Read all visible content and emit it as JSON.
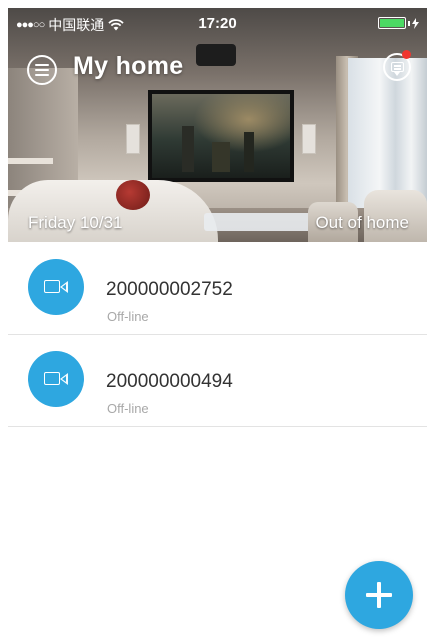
{
  "status_bar": {
    "signal": "●●●○○",
    "carrier": "中国联通",
    "wifi_icon": "wifi-icon",
    "time": "17:20",
    "battery_level": 1.0,
    "battery_color": "#4cd964"
  },
  "header": {
    "title": "My home",
    "menu_icon": "menu-icon",
    "message_icon": "message-icon",
    "has_unread": true
  },
  "hero": {
    "date": "Friday  10/31",
    "mode": "Out of home"
  },
  "devices": [
    {
      "id": "200000002752",
      "status": "Off-line",
      "icon": "camera-icon"
    },
    {
      "id": "200000000494",
      "status": "Off-line",
      "icon": "camera-icon"
    }
  ],
  "fab": {
    "icon": "plus-icon"
  },
  "colors": {
    "accent": "#2ea7e0",
    "unread_dot": "#f0352f",
    "status_text": "#a8a8a8",
    "name_text": "#333333"
  }
}
